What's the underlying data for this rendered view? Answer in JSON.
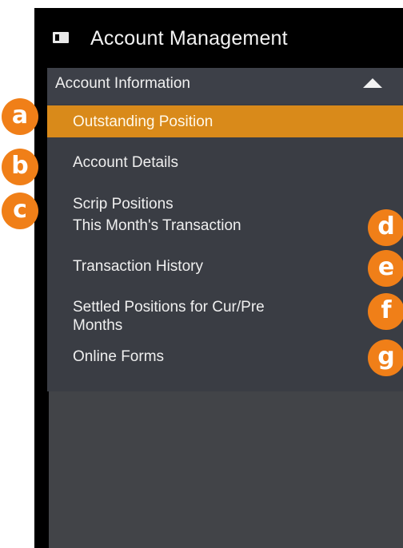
{
  "header": {
    "icon": "id-card-icon",
    "title": "Account Management"
  },
  "section": {
    "title": "Account Information",
    "toggle_icon": "caret-up-icon"
  },
  "menu": {
    "items": [
      {
        "label": "Outstanding Position",
        "active": true
      },
      {
        "label": "Account Details"
      },
      {
        "label": "Scrip Positions"
      },
      {
        "label": "This Month's Transaction"
      },
      {
        "label": "Transaction History"
      },
      {
        "label_line1": "Settled Positions for Cur/Pre",
        "label_line2": "Months"
      },
      {
        "label": "Online Forms"
      }
    ]
  },
  "badges": [
    "a",
    "b",
    "c",
    "d",
    "e",
    "f",
    "g"
  ],
  "colors": {
    "accent": "#d98a1a",
    "badge": "#f07f18",
    "panel_bg": "#3a3d44",
    "header_bg": "#000000"
  }
}
